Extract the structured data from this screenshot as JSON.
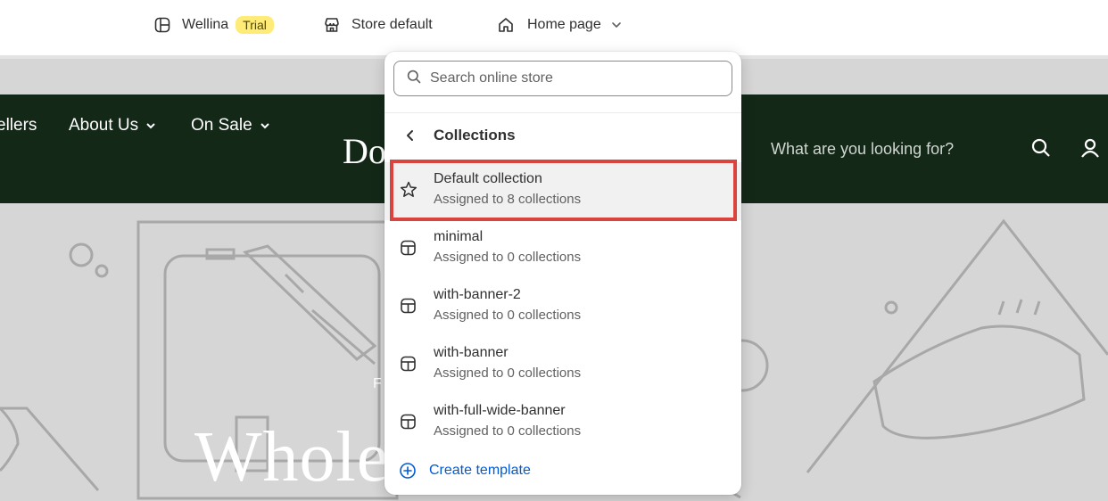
{
  "topbar": {
    "store_name": "Wellina",
    "badge": "Trial",
    "theme": "Store default",
    "page": "Home page"
  },
  "store_preview": {
    "nav": [
      "ellers",
      "About Us",
      "On Sale"
    ],
    "logo": "Doc",
    "search_placeholder": "What are you looking for?",
    "hero_small": "F",
    "hero_title": "Whole f"
  },
  "dropdown": {
    "search_placeholder": "Search online store",
    "section_title": "Collections",
    "templates": [
      {
        "name": "Default collection",
        "assigned": "Assigned to 8 collections",
        "icon": "star-icon"
      },
      {
        "name": "minimal",
        "assigned": "Assigned to 0 collections",
        "icon": "template-icon"
      },
      {
        "name": "with-banner-2",
        "assigned": "Assigned to 0 collections",
        "icon": "template-icon"
      },
      {
        "name": "with-banner",
        "assigned": "Assigned to 0 collections",
        "icon": "template-icon"
      },
      {
        "name": "with-full-wide-banner",
        "assigned": "Assigned to 0 collections",
        "icon": "template-icon"
      }
    ],
    "create_label": "Create template"
  },
  "colors": {
    "header_bg": "#142818",
    "highlight": "#d9443f",
    "link": "#005bd3",
    "badge_bg": "#ffeb78"
  }
}
